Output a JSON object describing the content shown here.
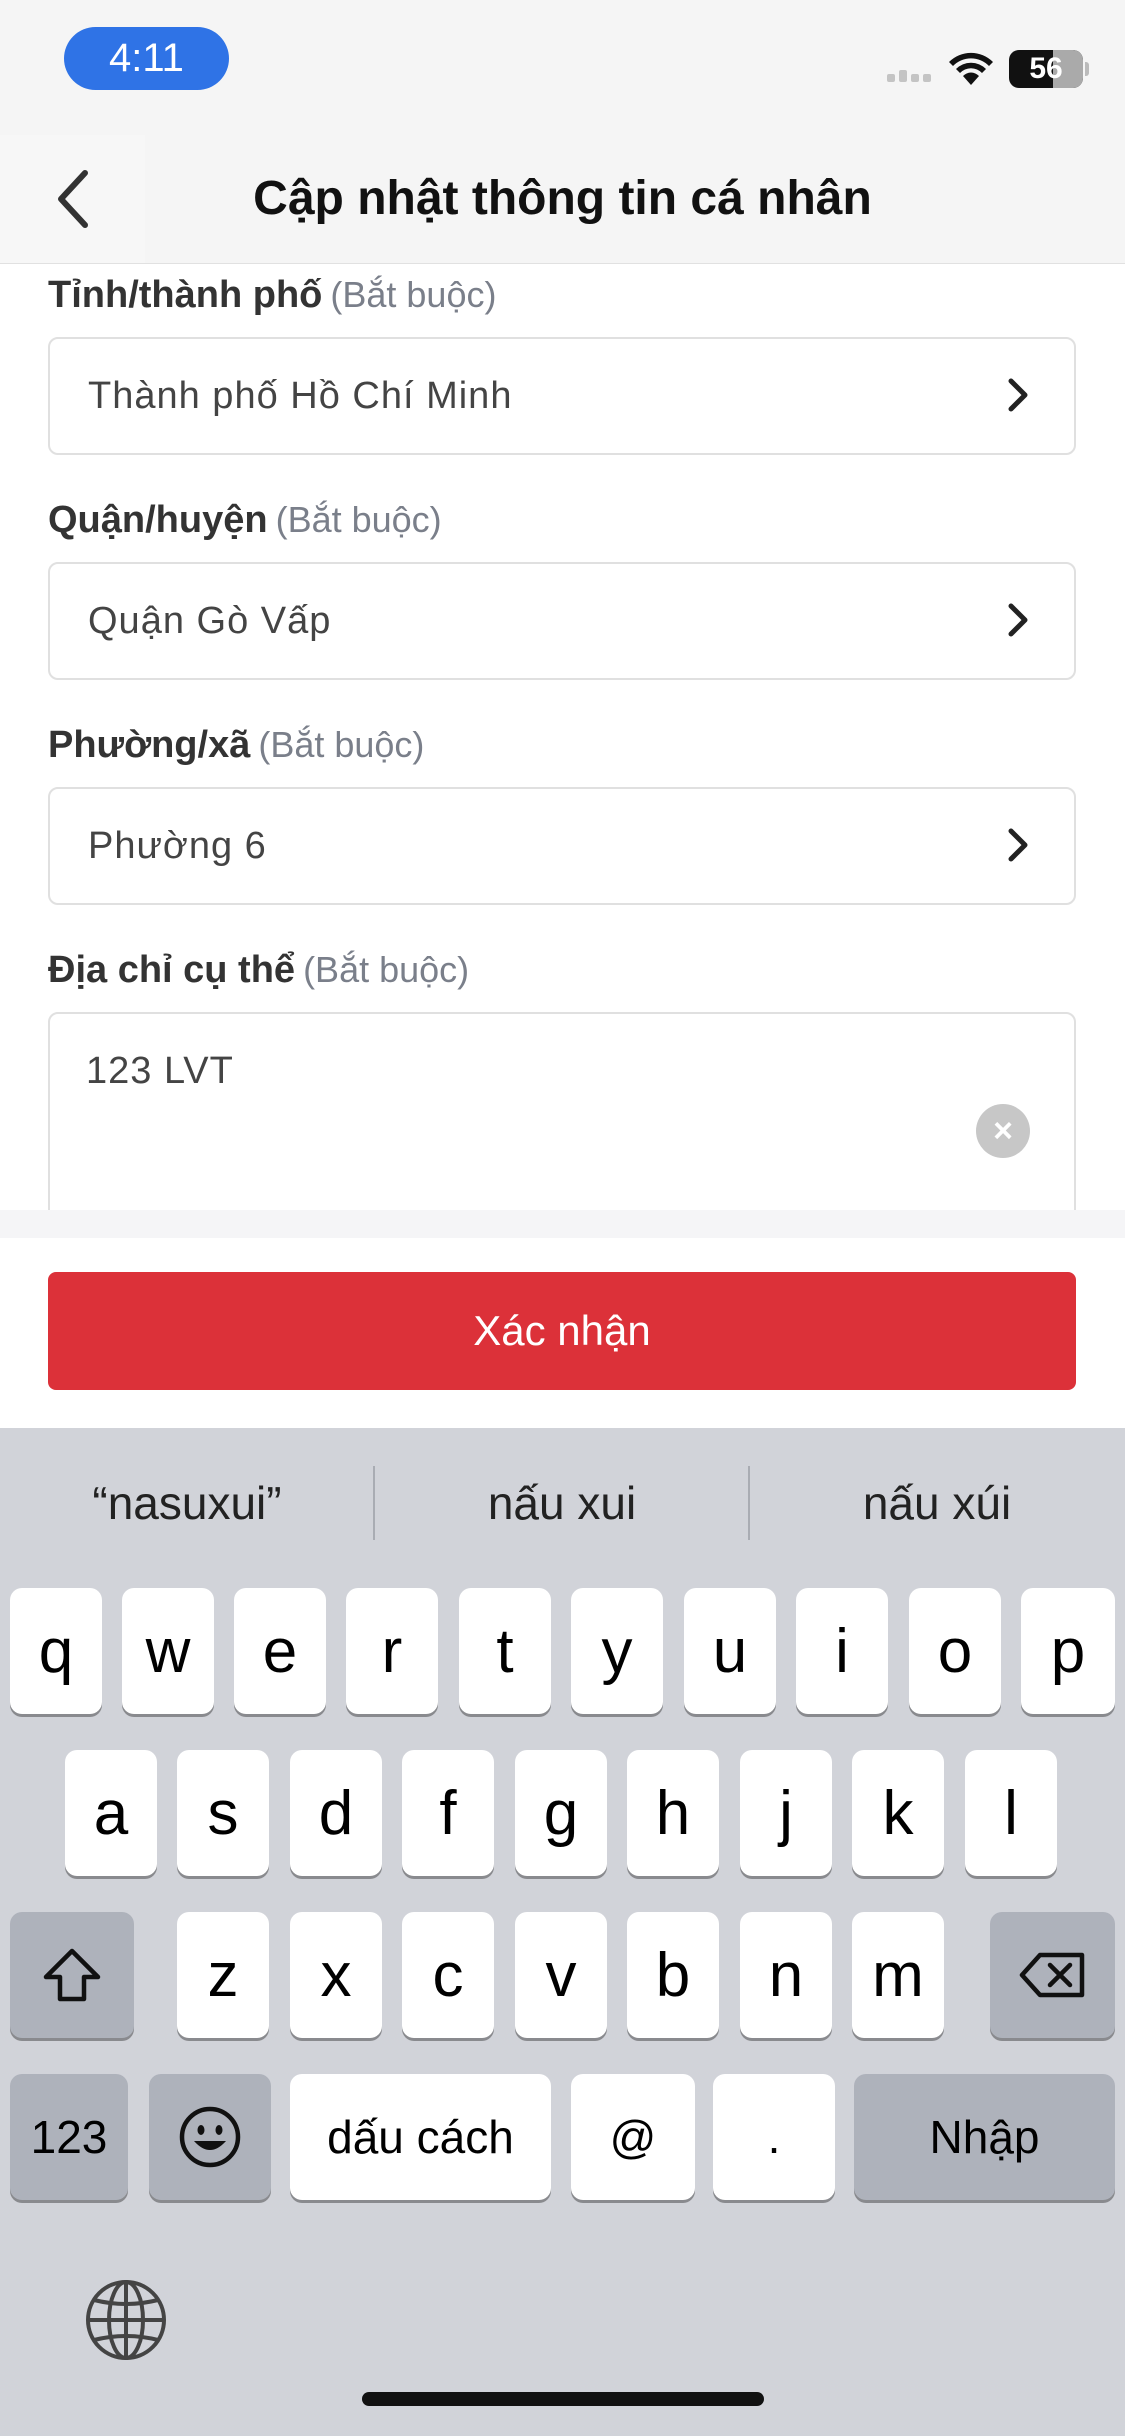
{
  "status_bar": {
    "time": "4:11",
    "battery": "56"
  },
  "header": {
    "title": "Cập nhật thông tin cá nhân"
  },
  "form": {
    "required_hint": "(Bắt buộc)",
    "province": {
      "label": "Tỉnh/thành phố",
      "value": "Thành phố Hồ Chí Minh"
    },
    "district": {
      "label": "Quận/huyện",
      "value": "Quận Gò Vấp"
    },
    "ward": {
      "label": "Phường/xã",
      "value": "Phường 6"
    },
    "address": {
      "label": "Địa chỉ cụ thể",
      "value": "123 LVT"
    }
  },
  "confirm_label": "Xác nhận",
  "keyboard": {
    "suggestions": [
      "“nasuxui”",
      "nấu xui",
      "nấu xúi"
    ],
    "row1": [
      "q",
      "w",
      "e",
      "r",
      "t",
      "y",
      "u",
      "i",
      "o",
      "p"
    ],
    "row2": [
      "a",
      "s",
      "d",
      "f",
      "g",
      "h",
      "j",
      "k",
      "l"
    ],
    "row3": [
      "z",
      "x",
      "c",
      "v",
      "b",
      "n",
      "m"
    ],
    "numbers_key": "123",
    "space_key": "dấu cách",
    "at_key": "@",
    "period_key": ".",
    "return_key": "Nhập"
  },
  "icons": [
    "back-chevron-icon",
    "wifi-icon",
    "signal-icon",
    "chevron-right-icon",
    "clear-icon",
    "shift-icon",
    "delete-icon",
    "emoji-icon",
    "globe-icon"
  ]
}
